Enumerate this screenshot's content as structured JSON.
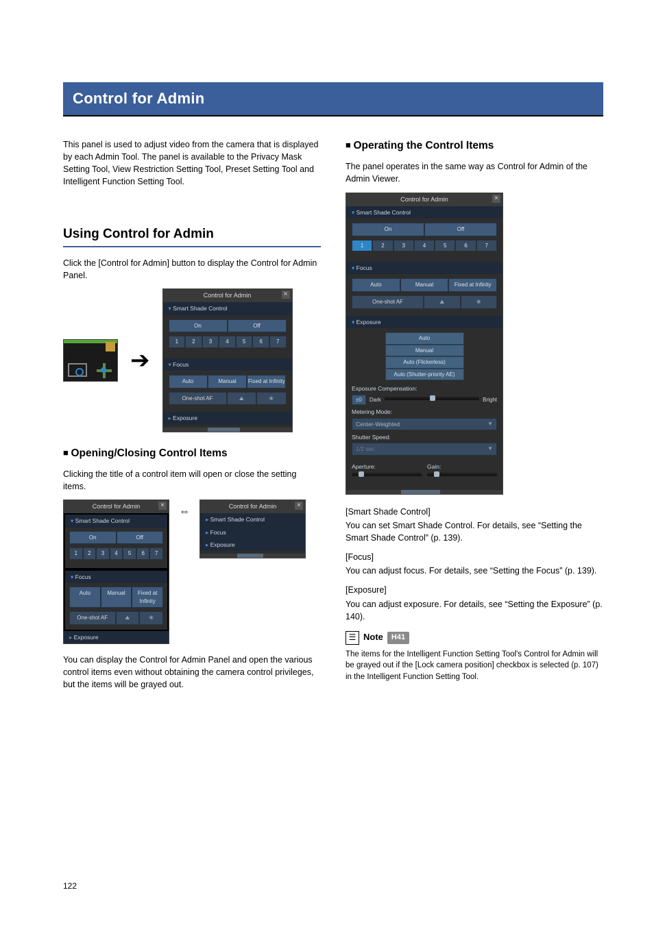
{
  "page": {
    "number": "122"
  },
  "title": "Control for Admin",
  "left": {
    "intro": "This panel is used to adjust video from the camera that is displayed by each Admin Tool. The panel is available to the Privacy Mask Setting Tool, View Restriction Setting Tool, Preset Setting Tool and Intelligent Function Setting Tool.",
    "h2": "Using Control for Admin",
    "p1": "Click the [Control for Admin] button to display the Control for Admin Panel.",
    "h3a": "Opening/Closing Control Items",
    "p2": "Clicking the title of a control item will open or close the setting items.",
    "p3": "You can display the Control for Admin Panel and open the various control items even without obtaining the camera control privileges, but the items will be grayed out."
  },
  "right": {
    "h3b": "Operating the Control Items",
    "p4": "The panel operates in the same way as Control for Admin of the Admin Viewer.",
    "ssc_head": "[Smart Shade Control]",
    "ssc_body": "You can set Smart Shade Control. For details, see “Setting the Smart Shade Control” (p. 139).",
    "focus_head": "[Focus]",
    "focus_body": "You can adjust focus. For details, see “Setting the Focus” (p. 139).",
    "exp_head": "[Exposure]",
    "exp_body": "You can adjust exposure. For details, see “Setting the Exposure” (p. 140).",
    "note_label": "Note",
    "note_tag": "H41",
    "note_text": "The items for the Intelligent Function Setting Tool's Control for Admin will be grayed out if the [Lock camera position] checkbox is selected (p. 107) in the Intelligent Function Setting Tool."
  },
  "panel": {
    "title": "Control for Admin",
    "ssc": "Smart Shade Control",
    "on": "On",
    "off": "Off",
    "nums": [
      "1",
      "2",
      "3",
      "4",
      "5",
      "6",
      "7"
    ],
    "focus": "Focus",
    "auto": "Auto",
    "manual": "Manual",
    "fixed": "Fixed at Infinity",
    "oneshot": "One-shot AF",
    "exposure": "Exposure",
    "auto2": "Auto",
    "manual2": "Manual",
    "autof": "Auto (Flickerless)",
    "autos": "Auto (Shutter-priority AE)",
    "expcomp": "Exposure Compensation:",
    "dark": "Dark",
    "bright": "Bright",
    "metering": "Metering Mode:",
    "meter_val": "Center-Weighted",
    "shutter": "Shutter Speed:",
    "shutter_val": "1/2 sec",
    "aperture": "Aperture:",
    "gain": "Gain:"
  }
}
